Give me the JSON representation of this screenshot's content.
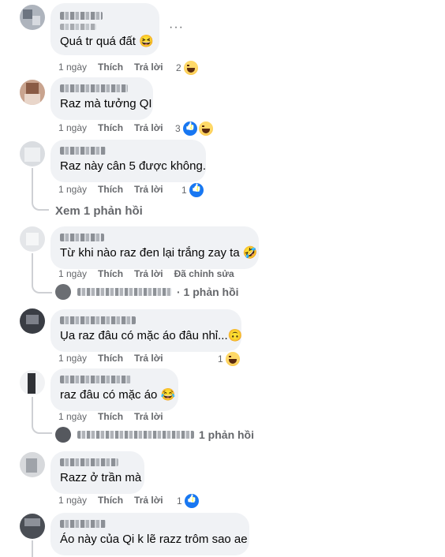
{
  "colors": {
    "bubble": "#f0f2f5",
    "meta": "#65676b",
    "like": "#1877f2",
    "line": "#ced0d4"
  },
  "actions": {
    "time": "1 ngày",
    "like": "Thích",
    "reply": "Trả lời",
    "edited": "Đã chỉnh sửa"
  },
  "more_icon": "···",
  "comments": [
    {
      "text": "Quá tr quá đất 😆",
      "reaction_count": "2",
      "reactions": [
        "haha"
      ]
    },
    {
      "text": "Raz mà tưởng QI",
      "reaction_count": "3",
      "reactions": [
        "like",
        "haha"
      ]
    },
    {
      "text": "Raz này cân 5 được không.",
      "reaction_count": "1",
      "reactions": [
        "like"
      ],
      "view_replies": "Xem 1 phản hồi"
    },
    {
      "text": "Từ khi nào raz đen lại trắng zay ta 🤣",
      "edited": true,
      "reply_summary": "· 1 phản hồi"
    },
    {
      "text": "Ụa raz đâu có mặc áo đâu nhỉ...🙃",
      "reaction_count": "1",
      "reactions": [
        "haha"
      ]
    },
    {
      "text": "raz đâu có mặc áo 😂",
      "reply_summary": "1 phản hồi"
    },
    {
      "text": "Razz ở trần mà",
      "reaction_count": "1",
      "reactions": [
        "like"
      ]
    },
    {
      "text": "Áo này của Qi k lẽ razz trôm sao ae"
    }
  ]
}
